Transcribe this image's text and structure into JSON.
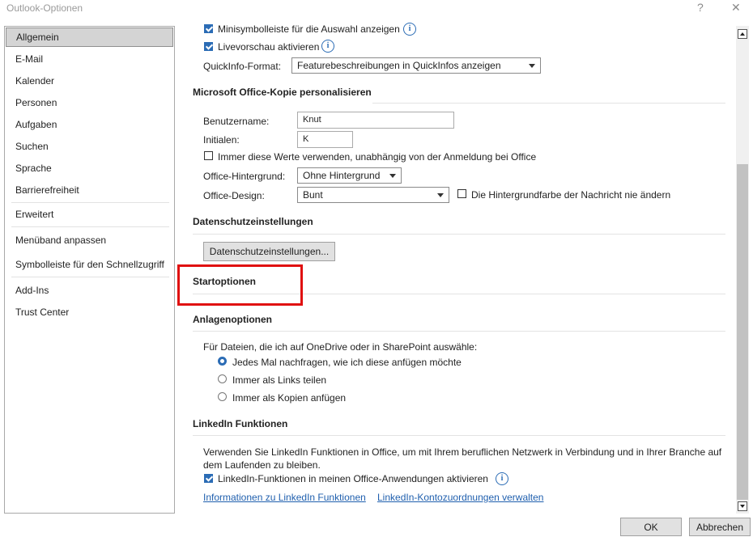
{
  "window": {
    "title": "Outlook-Optionen",
    "help": "?",
    "close": "✕"
  },
  "sidebar": {
    "items": [
      {
        "label": "Allgemein"
      },
      {
        "label": "E-Mail"
      },
      {
        "label": "Kalender"
      },
      {
        "label": "Personen"
      },
      {
        "label": "Aufgaben"
      },
      {
        "label": "Suchen"
      },
      {
        "label": "Sprache"
      },
      {
        "label": "Barrierefreiheit"
      },
      {
        "label": "Erweitert"
      },
      {
        "label": "Menüband anpassen"
      },
      {
        "label": "Symbolleiste für den Schnellzugriff"
      },
      {
        "label": "Add-Ins"
      },
      {
        "label": "Trust Center"
      }
    ],
    "selected": "Allgemein"
  },
  "ui": {
    "mini_toolbar": "Minisymbolleiste für die Auswahl anzeigen",
    "live_preview": "Livevorschau aktivieren",
    "quickinfo_label": "QuickInfo-Format:",
    "quickinfo_value": "Featurebeschreibungen in QuickInfos anzeigen"
  },
  "personalize": {
    "heading": "Microsoft Office-Kopie personalisieren",
    "username_label": "Benutzername:",
    "username_value": "Knut",
    "initials_label": "Initialen:",
    "initials_value": "K",
    "always_use": "Immer diese Werte verwenden, unabhängig von der Anmeldung bei Office",
    "background_label": "Office-Hintergrund:",
    "background_value": "Ohne Hintergrund",
    "design_label": "Office-Design:",
    "design_value": "Bunt",
    "never_change_bg": "Die Hintergrundfarbe der Nachricht nie ändern"
  },
  "privacy": {
    "heading": "Datenschutzeinstellungen",
    "button": "Datenschutzeinstellungen..."
  },
  "startup": {
    "heading": "Startoptionen"
  },
  "attachments": {
    "heading": "Anlagenoptionen",
    "intro": "Für Dateien, die ich auf OneDrive oder in SharePoint auswähle:",
    "options": [
      {
        "label": "Jedes Mal nachfragen, wie ich diese anfügen möchte",
        "selected": true
      },
      {
        "label": "Immer als Links teilen",
        "selected": false
      },
      {
        "label": "Immer als Kopien anfügen",
        "selected": false
      }
    ]
  },
  "linkedin": {
    "heading": "LinkedIn Funktionen",
    "description": "Verwenden Sie LinkedIn Funktionen in Office, um mit Ihrem beruflichen Netzwerk in Verbindung und in Ihrer Branche auf dem Laufenden zu bleiben.",
    "enable": "LinkedIn-Funktionen in meinen Office-Anwendungen aktivieren",
    "link_info": "Informationen zu LinkedIn Funktionen",
    "link_manage": "LinkedIn-Kontozuordnungen verwalten"
  },
  "footer": {
    "ok": "OK",
    "cancel": "Abbrechen"
  },
  "colors": {
    "accent": "#2b6cb5",
    "highlight": "#e01010",
    "link": "#1f5fae"
  },
  "icons": [
    "info-icon",
    "checkbox-checked",
    "dropdown-arrow-icon",
    "scroll-up-icon",
    "scroll-down-icon"
  ]
}
